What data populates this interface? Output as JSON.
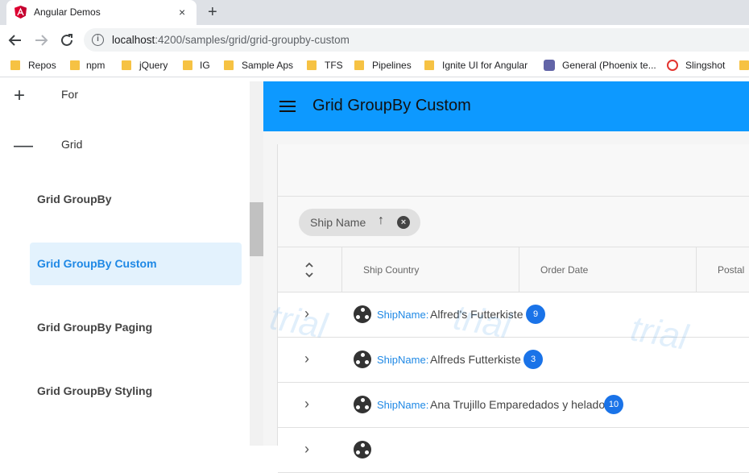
{
  "browser": {
    "tab_title": "Angular Demos",
    "tab_close": "×",
    "new_tab": "+",
    "url_host": "localhost",
    "url_rest": ":4200/samples/grid/grid-groupby-custom",
    "bookmarks": [
      "Repos",
      "npm",
      "jQuery",
      "IG",
      "Sample Aps",
      "TFS",
      "Pipelines",
      "Ignite UI for Angular",
      "General (Phoenix te...",
      "Slingshot"
    ]
  },
  "sidebar": {
    "groups": [
      {
        "symbol": "+",
        "label": "For"
      },
      {
        "symbol": "—",
        "label": "Grid"
      }
    ],
    "items": [
      {
        "label": "Grid GroupBy"
      },
      {
        "label": "Grid GroupBy Custom"
      },
      {
        "label": "Grid GroupBy Paging"
      },
      {
        "label": "Grid GroupBy Styling"
      }
    ]
  },
  "appbar": {
    "title": "Grid GroupBy Custom"
  },
  "grid": {
    "groupby_chip": {
      "label": "Ship Name",
      "arrow": "↑",
      "remove": "×"
    },
    "columns": [
      "Ship Country",
      "Order Date",
      "Postal"
    ],
    "group_rows": [
      {
        "field": "ShipName:",
        "value": "Alfred's Futterkiste",
        "count": "9"
      },
      {
        "field": "ShipName:",
        "value": "Alfreds Futterkiste",
        "count": "3"
      },
      {
        "field": "ShipName:",
        "value": "Ana Trujillo Emparedados y helados",
        "count": "10"
      }
    ],
    "watermark": "trial"
  }
}
